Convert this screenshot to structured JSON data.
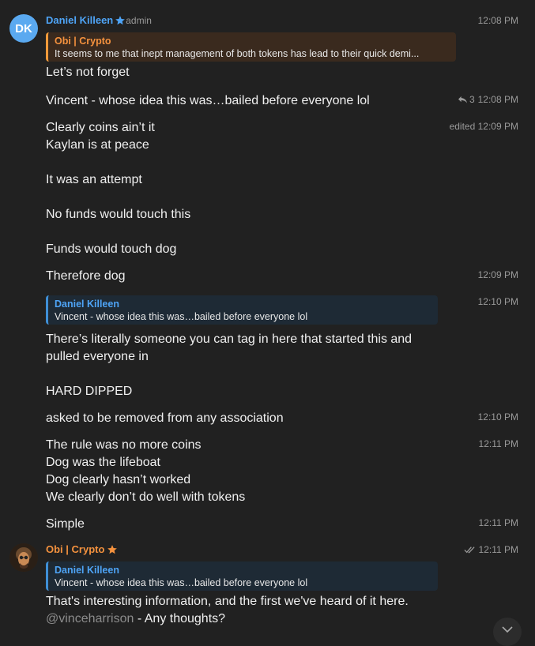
{
  "colors": {
    "background": "#212121",
    "daniel_name": "#4ea4f6",
    "obi_name": "#f5923e",
    "time": "#9a9a9a"
  },
  "header1": {
    "avatar_initials": "DK",
    "sender": "Daniel Killeen",
    "badge_icon": "star-icon",
    "role": "admin",
    "time": "12:08 PM"
  },
  "reply1": {
    "name": "Obi | Crypto",
    "text": "It seems to me that inept management of both tokens has lead to their quick demi..."
  },
  "m1": {
    "text": "Let’s not forget"
  },
  "m2": {
    "text": "Vincent - whose idea this was…bailed before everyone lol",
    "reply_count": "3",
    "time": "12:08 PM"
  },
  "m3": {
    "lines": [
      "Clearly coins ain’t it",
      "Kaylan is at peace",
      "It was an attempt",
      "No funds would touch this",
      "Funds would touch dog"
    ],
    "edited": "edited",
    "time": "12:09 PM"
  },
  "m4": {
    "text": "Therefore dog",
    "time": "12:09 PM"
  },
  "reply2": {
    "name": "Daniel Killeen",
    "text": "Vincent - whose idea this was…bailed before everyone lol"
  },
  "m5": {
    "lines": [
      "There’s literally someone you can tag in here that started this and",
      "pulled everyone in",
      "HARD DIPPED"
    ],
    "time": "12:10 PM"
  },
  "m6": {
    "text": "asked to be removed from any association",
    "time": "12:10 PM"
  },
  "m7": {
    "lines": [
      "The rule was no more coins",
      "Dog was the lifeboat",
      "Dog clearly hasn’t worked",
      "We clearly don’t do well with tokens"
    ],
    "time": "12:11 PM"
  },
  "m8": {
    "text": "Simple",
    "time": "12:11 PM"
  },
  "header2": {
    "sender": "Obi | Crypto",
    "badge_icon": "star-icon",
    "time": "12:11 PM",
    "read_icon": "double-check-icon"
  },
  "reply3": {
    "name": "Daniel Killeen",
    "text": "Vincent - whose idea this was…bailed before everyone lol"
  },
  "m9": {
    "line1": "That's interesting information, and the first we've heard of it here.",
    "mention": "@vinceharrison",
    "line2_rest": " - Any thoughts?"
  }
}
